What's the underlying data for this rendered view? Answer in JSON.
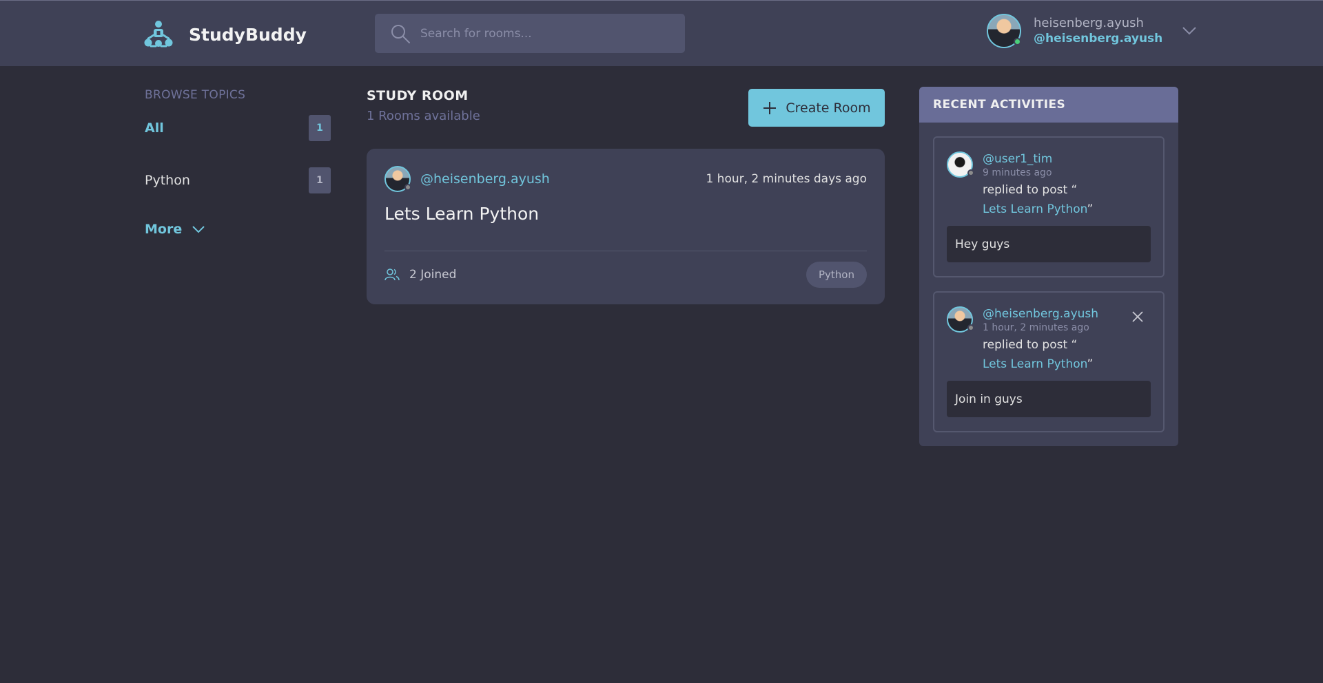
{
  "header": {
    "brand": "StudyBuddy",
    "search_placeholder": "Search for rooms...",
    "user_name": "heisenberg.ayush",
    "user_handle": "@heisenberg.ayush"
  },
  "sidebar": {
    "heading": "BROWSE TOPICS",
    "topics": [
      {
        "label": "All",
        "count": "1"
      },
      {
        "label": "Python",
        "count": "1"
      }
    ],
    "more_label": "More"
  },
  "main": {
    "title": "STUDY ROOM",
    "count_text": "1 Rooms available",
    "create_label": "Create Room",
    "rooms": [
      {
        "host": "@heisenberg.ayush",
        "time": "1 hour, 2 minutes days ago",
        "name": "Lets Learn Python",
        "joined": "2 Joined",
        "topic": "Python"
      }
    ]
  },
  "activities": {
    "heading": "RECENT ACTIVITIES",
    "items": [
      {
        "user": "@user1_tim",
        "time": "9 minutes ago",
        "action": "replied to post “",
        "post": "Lets Learn Python",
        "post_close_quote": "”",
        "message": "Hey guys"
      },
      {
        "user": "@heisenberg.ayush",
        "time": "1 hour, 2 minutes ago",
        "action": "replied to post “",
        "post": "Lets Learn Python",
        "post_close_quote": "”",
        "message": "Join in guys"
      }
    ]
  },
  "colors": {
    "background": "#2d2d39",
    "surface": "#3f4156",
    "accent": "#71c6dd",
    "header_panel": "#696d97",
    "online": "#4ad07a"
  },
  "icons": [
    "logo-icon",
    "search-icon",
    "chevron-down-icon",
    "plus-icon",
    "users-icon",
    "close-icon"
  ]
}
